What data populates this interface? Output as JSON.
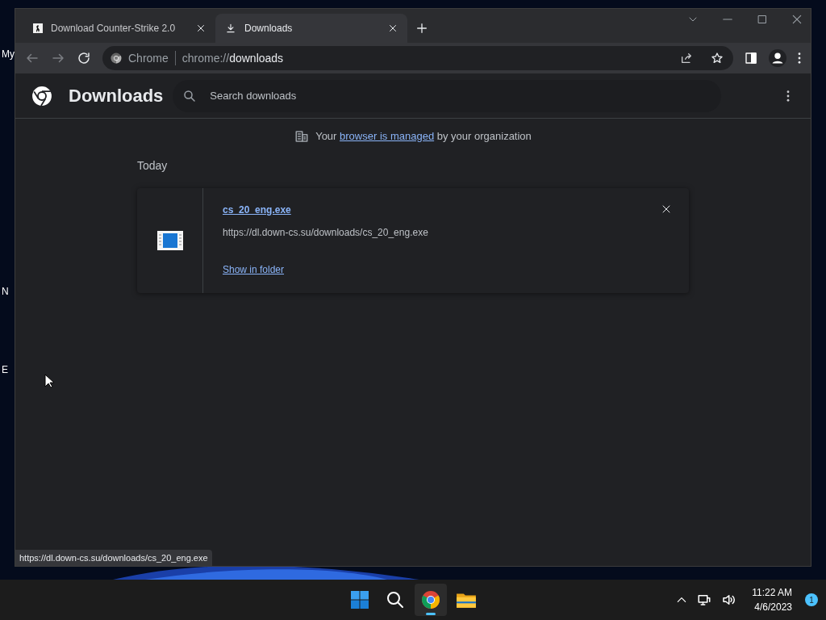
{
  "desktop": {
    "icon_labels": [
      "My",
      "N",
      "E"
    ]
  },
  "browser": {
    "tabs": [
      {
        "title": "Download Counter-Strike 2.0",
        "kind": "site",
        "selected": false
      },
      {
        "title": "Downloads",
        "kind": "downloads",
        "selected": true
      }
    ],
    "address": {
      "origin_label": "Chrome",
      "url_prefix": "chrome://",
      "url_path": "downloads"
    }
  },
  "page": {
    "title": "Downloads",
    "search": {
      "placeholder": "Search downloads"
    },
    "managed_notice": {
      "before": "Your",
      "link": "browser is managed",
      "after": "by your organization"
    },
    "section": "Today",
    "downloads": [
      {
        "file_name": "cs_20_eng.exe",
        "url": "https://dl.down-cs.su/downloads/cs_20_eng.exe",
        "action": "Show in folder"
      }
    ]
  },
  "status_bubble": "https://dl.down-cs.su/downloads/cs_20_eng.exe",
  "taskbar": {
    "apps": [
      {
        "kind": "start",
        "selected": false
      },
      {
        "kind": "search",
        "selected": false
      },
      {
        "kind": "chrome",
        "selected": true
      },
      {
        "kind": "files",
        "selected": false
      }
    ],
    "time": "11:22 AM",
    "date": "4/6/2023",
    "notification_count": "1"
  }
}
